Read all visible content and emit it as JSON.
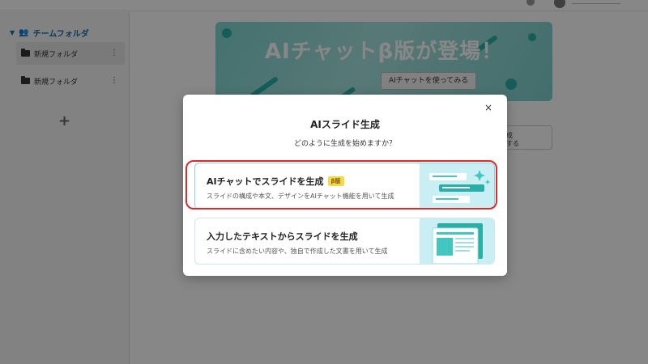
{
  "sidebar": {
    "team_label": "チームフォルダ",
    "folders": [
      {
        "label": "新規フォルダ"
      },
      {
        "label": "新規フォルダ"
      }
    ],
    "add_label": "+"
  },
  "banner": {
    "title": "AIチャットβ版が登場！",
    "button": "AIチャットを使ってみる"
  },
  "background_card": {
    "line1": "成",
    "line2": "する"
  },
  "modal": {
    "close": "×",
    "title": "AIスライド生成",
    "subtitle": "どのように生成を始めますか？",
    "options": [
      {
        "title": "AIチャットでスライドを生成",
        "badge": "β版",
        "desc": "スライドの構成や本文、デザインをAIチャット機能を用いて生成"
      },
      {
        "title": "入力したテキストからスライドを生成",
        "desc": "スライドに含めたい内容や、独自で作成した文書を用いて生成"
      }
    ]
  },
  "colors": {
    "accent": "#2aaea8",
    "highlight": "#e02a2a",
    "badge": "#f6d84a"
  }
}
